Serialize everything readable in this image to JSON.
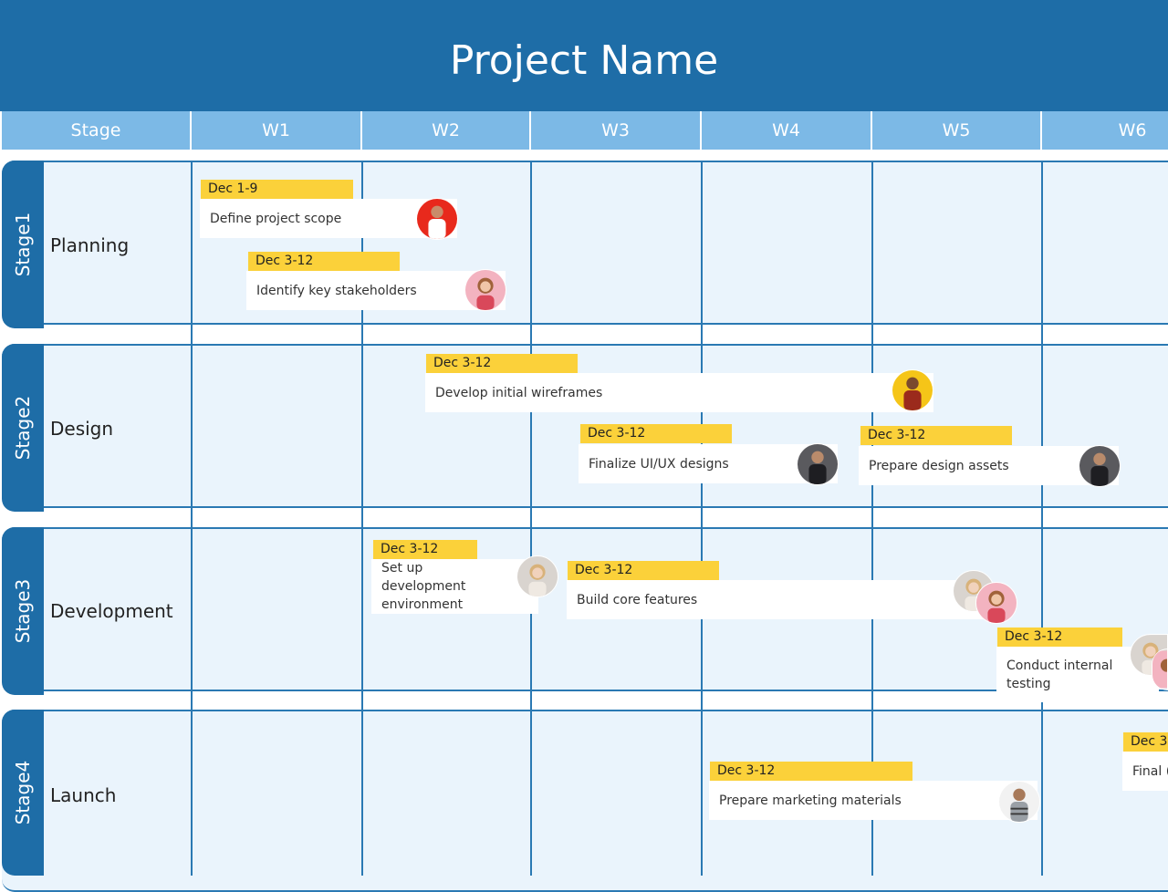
{
  "title": "Project Name",
  "columns": [
    "Stage",
    "W1",
    "W2",
    "W3",
    "W4",
    "W5",
    "W6"
  ],
  "stages": [
    {
      "tab": "Stage1",
      "name": "Planning"
    },
    {
      "tab": "Stage2",
      "name": "Design"
    },
    {
      "tab": "Stage3",
      "name": "Development"
    },
    {
      "tab": "Stage4",
      "name": "Launch"
    }
  ],
  "tasks": [
    {
      "date": "Dec 1-9",
      "name": "Define project scope",
      "avatar": "person-red-bg"
    },
    {
      "date": "Dec 3-12",
      "name": "Identify key stakeholders",
      "avatar": "woman-pink-bg"
    },
    {
      "date": "Dec 3-12",
      "name": "Develop initial wireframes",
      "avatar": "person-yellow-bg"
    },
    {
      "date": "Dec 3-12",
      "name": "Finalize UI/UX designs",
      "avatar": "person-dark-bg"
    },
    {
      "date": "Dec 3-12",
      "name": "Prepare design assets",
      "avatar": "person-dark-bg"
    },
    {
      "date": "Dec 3-12",
      "name": "Set up development environment",
      "avatar": "woman-light-bg"
    },
    {
      "date": "Dec 3-12",
      "name": "Build core features",
      "avatar": "two-women"
    },
    {
      "date": "Dec 3-12",
      "name": "Conduct internal testing",
      "avatar": "two-women"
    },
    {
      "date": "Dec 3-12",
      "name": "Prepare marketing materials",
      "avatar": "man-light-bg"
    },
    {
      "date": "Dec 3-",
      "name": "Final (",
      "avatar": ""
    }
  ],
  "colors": {
    "header": "#1e6da7",
    "subheader": "#7cb9e6",
    "row_bg": "#eaf4fc",
    "chip": "#fbd13a"
  }
}
